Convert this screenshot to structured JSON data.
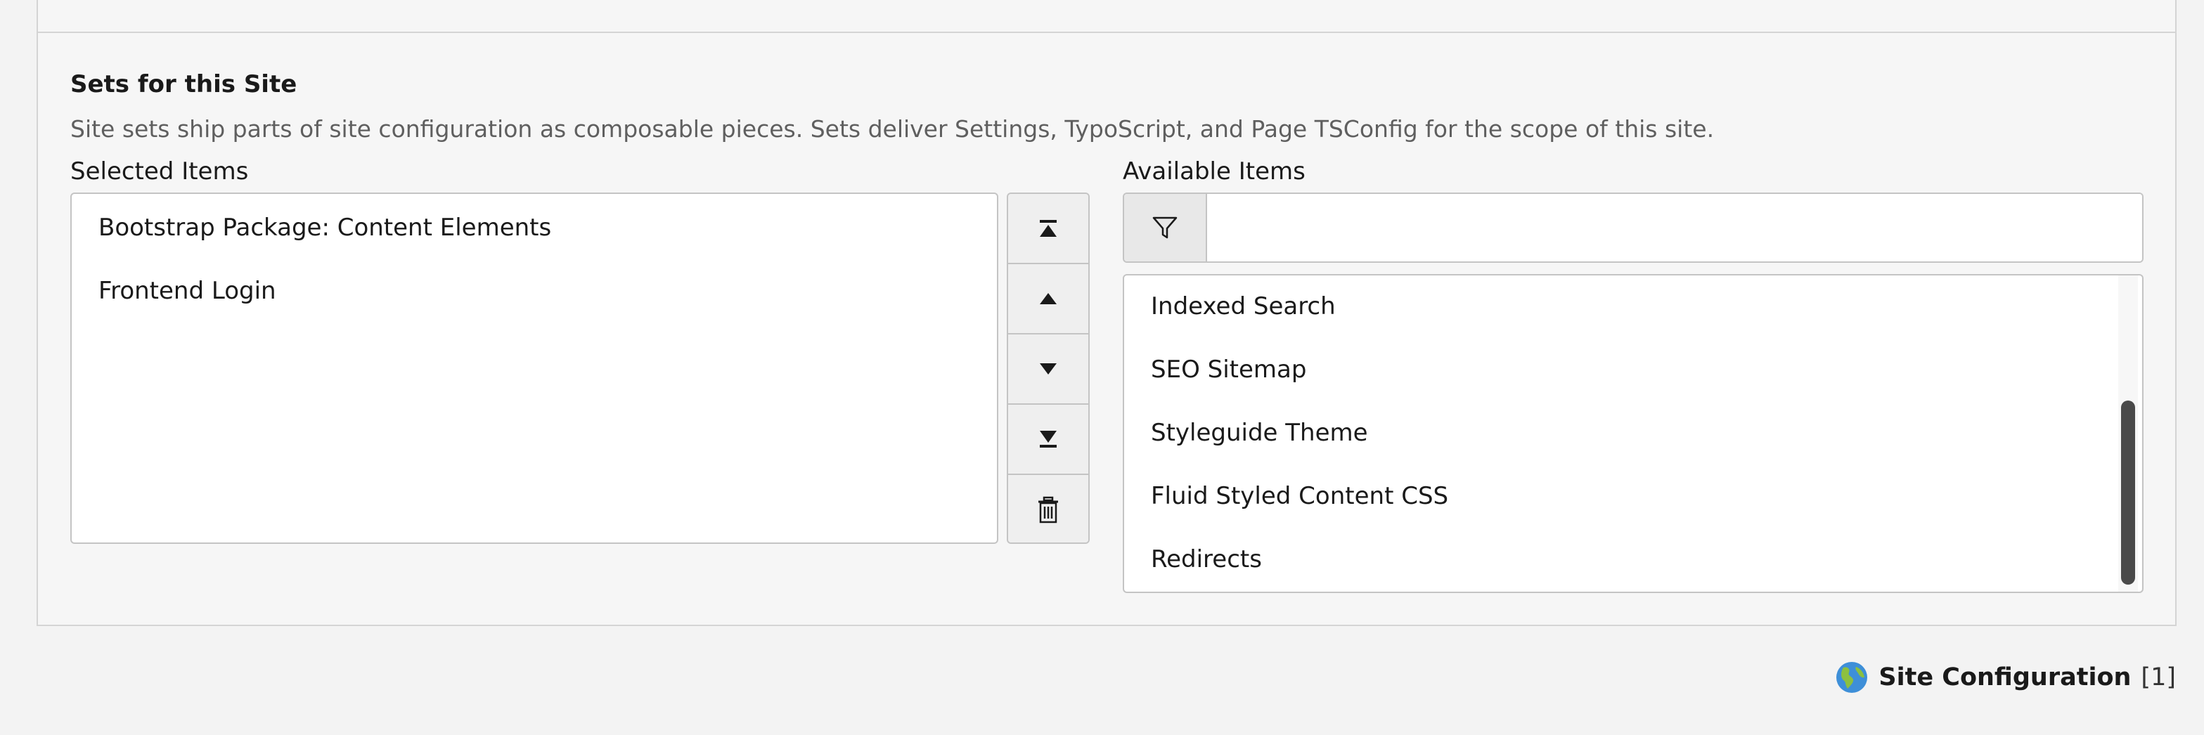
{
  "section": {
    "title": "Sets for this Site",
    "description": "Site sets ship parts of site configuration as composable pieces. Sets deliver Settings, TypoScript, and Page TSConfig for the scope of this site."
  },
  "selected": {
    "label": "Selected Items",
    "items": [
      "Bootstrap Package: Content Elements",
      "Frontend Login"
    ]
  },
  "available": {
    "label": "Available Items",
    "filter_value": "",
    "items": [
      "Indexed Search",
      "SEO Sitemap",
      "Styleguide Theme",
      "Fluid Styled Content CSS",
      "Redirects"
    ]
  },
  "controls": {
    "icons": [
      "move-to-top-icon",
      "move-up-icon",
      "move-down-icon",
      "move-to-bottom-icon",
      "trash-icon"
    ]
  },
  "footer": {
    "icon": "globe-icon",
    "name": "Site Configuration",
    "count": "[1]"
  }
}
